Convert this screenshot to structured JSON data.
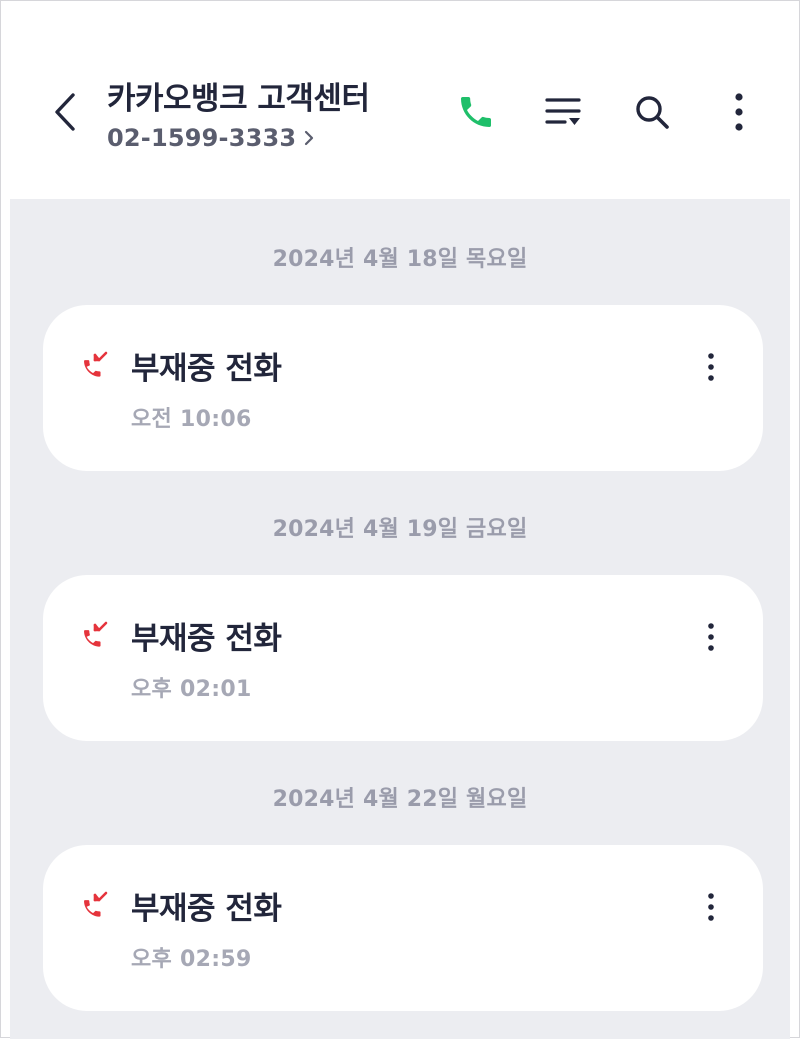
{
  "header": {
    "contact_name": "카카오뱅크 고객센터",
    "phone_number": "02-1599-3333",
    "icons": {
      "back": "chevron-left-icon",
      "phone_more": "chevron-right-icon",
      "call": "phone-icon",
      "filter": "filter-list-icon",
      "search": "search-icon",
      "more": "more-vertical-icon"
    }
  },
  "colors": {
    "call_green": "#1fbf6a",
    "missed_red": "#e5343c",
    "text_dark": "#22263b",
    "background_gray": "#ecedf1"
  },
  "call_log": [
    {
      "date": "2024년 4월 18일 목요일",
      "type": "부재중 전화",
      "time": "오전 10:06",
      "icon": "missed-call-icon"
    },
    {
      "date": "2024년 4월 19일 금요일",
      "type": "부재중 전화",
      "time": "오후 02:01",
      "icon": "missed-call-icon"
    },
    {
      "date": "2024년 4월 22일 월요일",
      "type": "부재중 전화",
      "time": "오후 02:59",
      "icon": "missed-call-icon"
    }
  ]
}
